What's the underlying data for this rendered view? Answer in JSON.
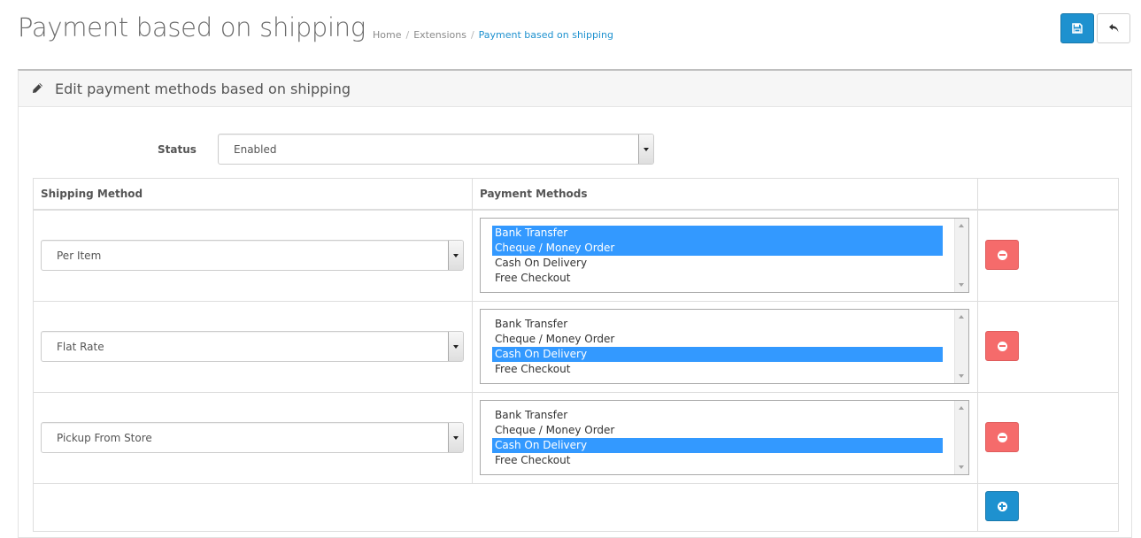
{
  "header": {
    "title": "Payment based on shipping",
    "breadcrumb": [
      "Home",
      "Extensions",
      "Payment based on shipping"
    ],
    "breadcrumb_separator": "/",
    "save_icon": "floppy-disk-icon",
    "back_icon": "reply-arrow-icon"
  },
  "panel": {
    "title": "Edit payment methods based on shipping",
    "icon": "pencil-icon"
  },
  "status": {
    "label": "Status",
    "value": "Enabled"
  },
  "table": {
    "columns": [
      "Shipping Method",
      "Payment Methods",
      ""
    ],
    "rows": [
      {
        "shipping": "Per Item",
        "payments": [
          {
            "label": "Bank Transfer",
            "selected": true
          },
          {
            "label": "Cheque / Money Order",
            "selected": true
          },
          {
            "label": "Cash On Delivery",
            "selected": false
          },
          {
            "label": "Free Checkout",
            "selected": false
          }
        ]
      },
      {
        "shipping": "Flat Rate",
        "payments": [
          {
            "label": "Bank Transfer",
            "selected": false
          },
          {
            "label": "Cheque / Money Order",
            "selected": false
          },
          {
            "label": "Cash On Delivery",
            "selected": true
          },
          {
            "label": "Free Checkout",
            "selected": false
          }
        ]
      },
      {
        "shipping": "Pickup From Store",
        "payments": [
          {
            "label": "Bank Transfer",
            "selected": false
          },
          {
            "label": "Cheque / Money Order",
            "selected": false
          },
          {
            "label": "Cash On Delivery",
            "selected": true
          },
          {
            "label": "Free Checkout",
            "selected": false
          }
        ]
      }
    ]
  },
  "colors": {
    "primary": "#1e91cf",
    "danger": "#f56b6b",
    "selected": "#3399ff"
  }
}
